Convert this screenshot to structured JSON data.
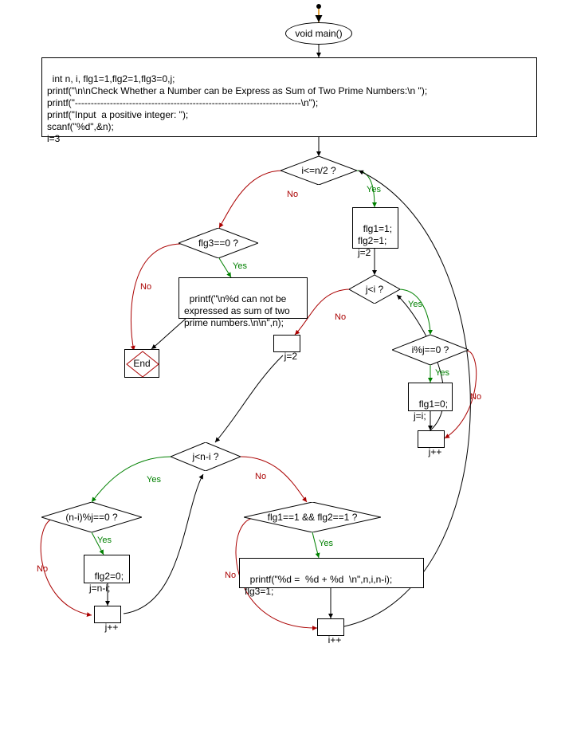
{
  "nodes": {
    "start": "void main()",
    "init_block": "int n, i, flg1=1,flg2=1,flg3=0,j;\nprintf(\"\\n\\nCheck Whether a Number can be Express as Sum of Two Prime Numbers:\\n \");\nprintf(\"-----------------------------------------------------------------------\\n\");\nprintf(\"Input  a positive integer: \");\nscanf(\"%d\",&n);\ni=3",
    "cond_i_le_n2": "i<=n/2 ?",
    "set_flgs": "flg1=1;\nflg2=1;\nj=2",
    "cond_j_lt_i": "j<i ?",
    "cond_i_mod_j": "i%j==0 ?",
    "set_flg1_0": "flg1=0;\nj=i;",
    "jpp_inner1": "j++",
    "j_eq_2": "j=2",
    "cond_j_lt_n_i": "j<n-i ?",
    "cond_ni_mod_j": "(n-i)%j==0 ?",
    "set_flg2_0": "flg2=0;\nj=n-i;",
    "jpp_inner2": "j++",
    "cond_both_flg": "flg1==1 && flg2==1 ?",
    "print_sum": "printf(\"%d =  %d + %d  \\n\",n,i,n-i);\nflg3=1;",
    "ipp": "i++",
    "cond_flg3": "flg3==0 ?",
    "print_fail": "printf(\"\\n%d can not be\nexpressed as sum of two\nprime numbers.\\n\\n\",n);",
    "end": "End"
  },
  "labels": {
    "yes": "Yes",
    "no": "No"
  },
  "colors": {
    "yes": "#008000",
    "no": "#aa0000",
    "black": "#000000"
  }
}
